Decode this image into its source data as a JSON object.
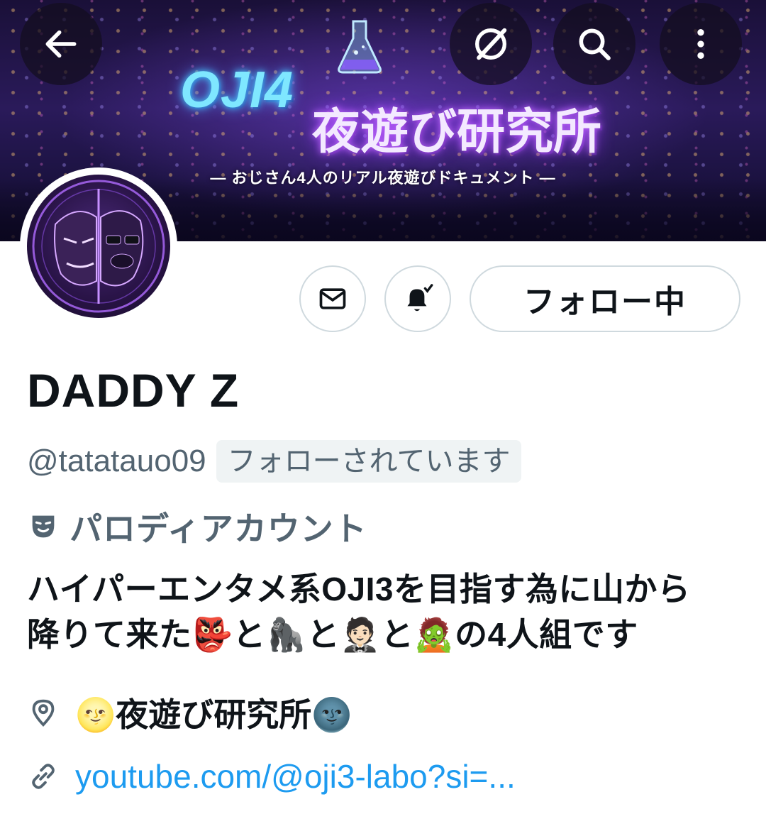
{
  "banner": {
    "logo_latin": "OJI4",
    "logo_jp": "夜遊び研究所",
    "subtitle": "— おじさん4人のリアル夜遊びドキュメント —"
  },
  "top_bar": {
    "icons": [
      "back-arrow-icon",
      "sparkle-slash-icon",
      "search-icon",
      "more-vertical-icon"
    ]
  },
  "actions": {
    "follow_label": "フォロー中"
  },
  "profile": {
    "name": "DADDY Z",
    "handle": "@tatatauo09",
    "follows_you_badge": "フォローされています",
    "parody_label": "パロディアカウント",
    "bio_line1": "ハイパーエンタメ系OJI3を目指す為に山から",
    "bio_line2_a": "降りて来た",
    "bio_line2_b": "と",
    "bio_line2_c": "と",
    "bio_line2_d": "と",
    "bio_line2_e": "の4人組です",
    "bio_emojis": [
      "👺",
      "🦍",
      "🤵🏻",
      "🧟"
    ],
    "location": "夜遊び研究所",
    "location_emoji_left": "🌝",
    "location_emoji_right": "🌚",
    "link": "youtube.com/@oji3-labo?si=..."
  },
  "colors": {
    "text_primary": "#0f1419",
    "text_secondary": "#536471",
    "link": "#1d9bf0",
    "border": "#cfd9de",
    "badge_bg": "#eff3f4"
  }
}
